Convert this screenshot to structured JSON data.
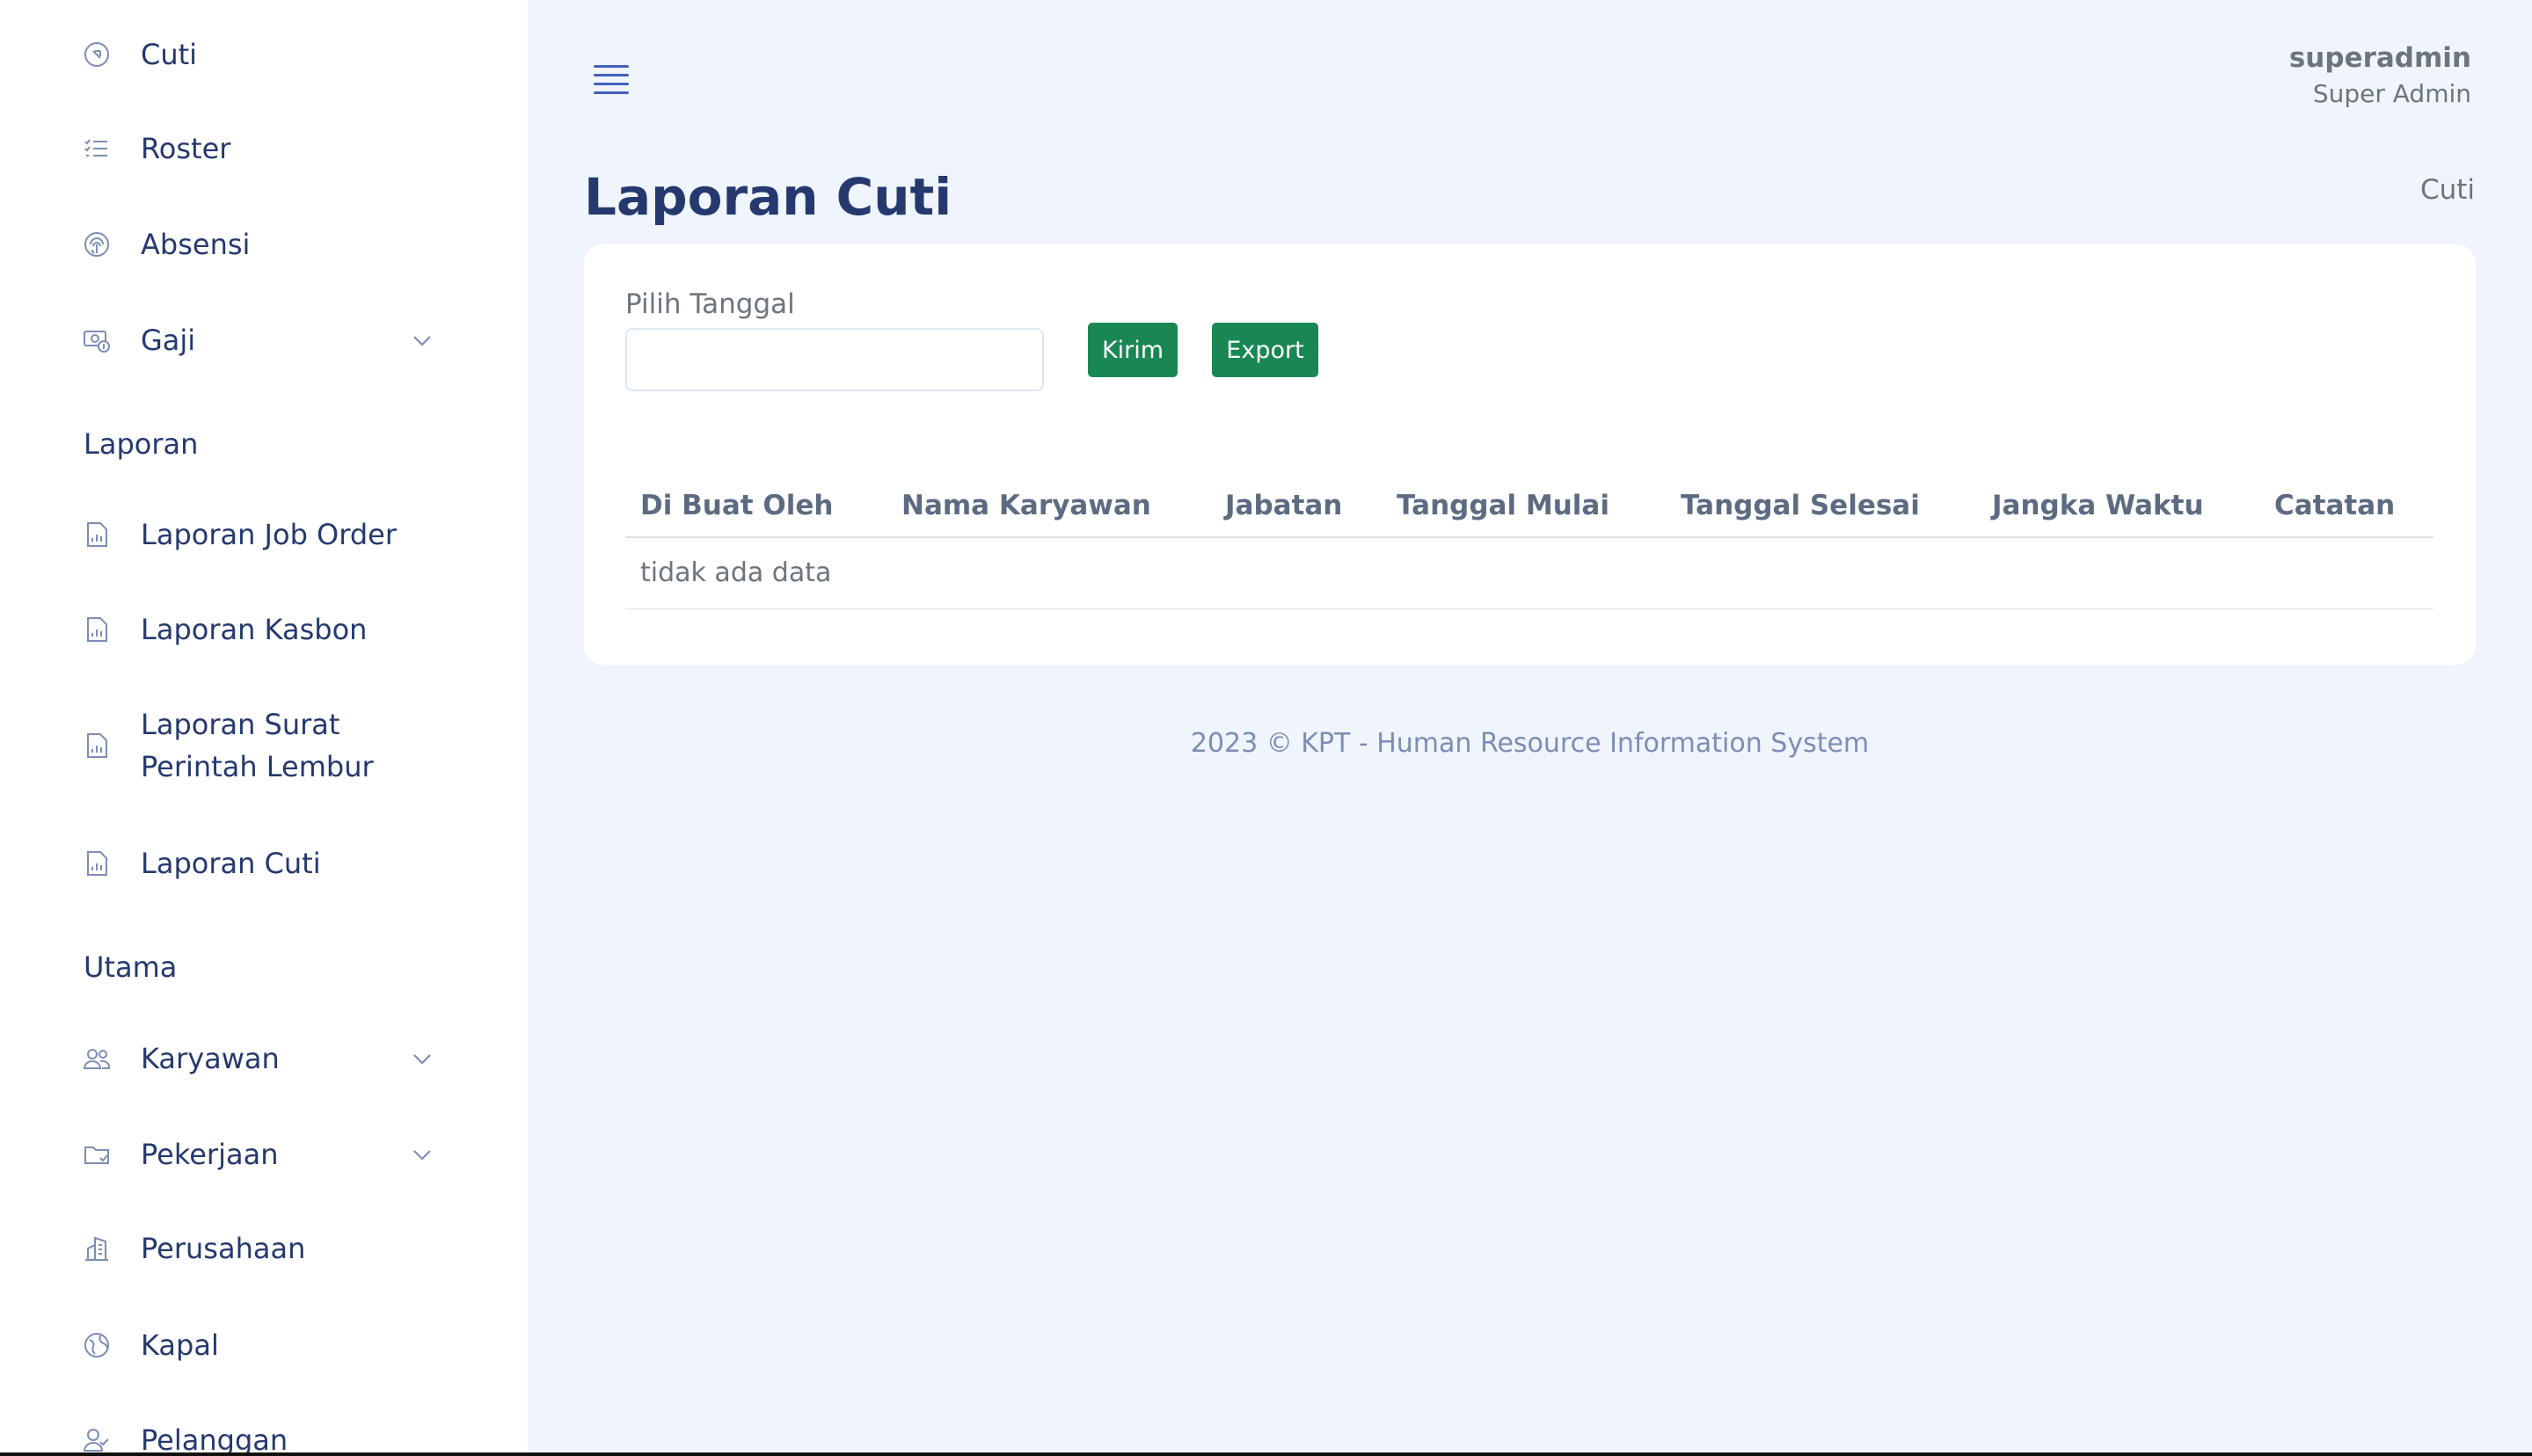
{
  "sidebar": {
    "items_top": [
      {
        "label": "Cuti",
        "icon": "arrow-up-left-circle-icon"
      },
      {
        "label": "Roster",
        "icon": "list-icon"
      },
      {
        "label": "Absensi",
        "icon": "fingerprint-icon"
      },
      {
        "label": "Gaji",
        "icon": "cash-coin-icon",
        "has_chevron": true
      }
    ],
    "section_laporan": "Laporan",
    "items_laporan": [
      {
        "label": "Laporan Job Order",
        "icon": "file-chart-icon"
      },
      {
        "label": "Laporan Kasbon",
        "icon": "file-chart-icon"
      },
      {
        "label": "Laporan Surat Perintah Lembur",
        "icon": "file-chart-icon"
      },
      {
        "label": "Laporan Cuti",
        "icon": "file-chart-icon"
      }
    ],
    "section_utama": "Utama",
    "items_utama": [
      {
        "label": "Karyawan",
        "icon": "people-icon",
        "has_chevron": true
      },
      {
        "label": "Pekerjaan",
        "icon": "folder-icon",
        "has_chevron": true
      },
      {
        "label": "Perusahaan",
        "icon": "building-icon"
      },
      {
        "label": "Kapal",
        "icon": "globe-icon"
      },
      {
        "label": "Pelanggan",
        "icon": "person-check-icon"
      }
    ]
  },
  "header": {
    "user_name": "superadmin",
    "user_role": "Super Admin"
  },
  "page": {
    "title": "Laporan Cuti",
    "breadcrumb": "Cuti"
  },
  "form": {
    "date_label": "Pilih Tanggal",
    "date_value": "",
    "submit_label": "Kirim",
    "export_label": "Export"
  },
  "table": {
    "columns": [
      "Di Buat Oleh",
      "Nama Karyawan",
      "Jabatan",
      "Tanggal Mulai",
      "Tanggal Selesai",
      "Jangka Waktu",
      "Catatan"
    ],
    "empty_text": "tidak ada data"
  },
  "footer": {
    "text": "2023 © KPT - Human Resource Information System"
  },
  "colors": {
    "primary": "#435ebe",
    "text_dark": "#25396f",
    "button_green": "#198754",
    "background": "#f0f5fd"
  }
}
